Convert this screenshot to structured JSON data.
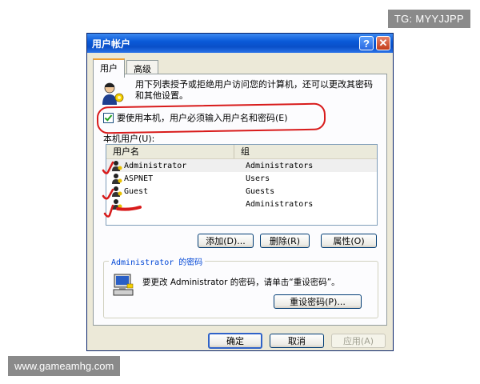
{
  "watermarks": {
    "top": "TG: MYYJJPP",
    "bottom": "www.gameamhg.com"
  },
  "window": {
    "title": "用户帐户",
    "help_glyph": "?",
    "close_glyph": "✕"
  },
  "tabs": [
    {
      "label": "用户",
      "active": true
    },
    {
      "label": "高级",
      "active": false
    }
  ],
  "intro": {
    "icon": "users-icon",
    "text": "用下列表授予或拒绝用户访问您的计算机，还可以更改其密码和其他设置。"
  },
  "require_login": {
    "label": "要使用本机，用户必须输入用户名和密码(E)",
    "checked": true
  },
  "users_list": {
    "label": "本机用户(U):",
    "columns": [
      "用户名",
      "组"
    ],
    "rows": [
      {
        "name": "Administrator",
        "group": "Administrators",
        "selected": true
      },
      {
        "name": "ASPNET",
        "group": "Users",
        "selected": false
      },
      {
        "name": "Guest",
        "group": "Guests",
        "selected": false
      },
      {
        "name": "",
        "group": "Administrators",
        "selected": false
      }
    ]
  },
  "list_buttons": {
    "add": "添加(D)...",
    "remove": "删除(R)",
    "properties": "属性(O)"
  },
  "password_group": {
    "title": "Administrator 的密码",
    "text": "要更改 Administrator 的密码，请单击“重设密码”。",
    "reset_button": "重设密码(P)..."
  },
  "footer_buttons": {
    "ok": "确定",
    "cancel": "取消",
    "apply": "应用(A)"
  },
  "colors": {
    "titlebar": "#0a5ad8",
    "annotation": "#d81b1b",
    "group_title": "#0046d5"
  }
}
